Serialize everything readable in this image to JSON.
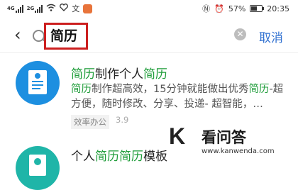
{
  "status_bar": {
    "network_left": "4G",
    "network_right": "2G",
    "battery": "57%",
    "time": "20:35",
    "battery_level": 0.57
  },
  "search": {
    "back_icon": "chevron-left-icon",
    "query": "简历",
    "cancel_label": "取消"
  },
  "results": [
    {
      "title_parts": [
        "简历",
        "制作个人",
        "简历"
      ],
      "desc_parts": [
        "简历",
        "制作超高效，15分钟就能做出优秀",
        "简历",
        "-超方便，随时修改、分享、投递- 超智能，…"
      ],
      "tag": "效率办公",
      "rating": "3.9",
      "icon_color": "#1d8fe0"
    },
    {
      "title_parts": [
        "个人",
        "简历",
        "简历",
        "模板"
      ],
      "icon_color": "#1fb5a8"
    }
  ],
  "watermark": {
    "logo": "K",
    "title": "看问答",
    "url": "www.kanwenda.com"
  }
}
